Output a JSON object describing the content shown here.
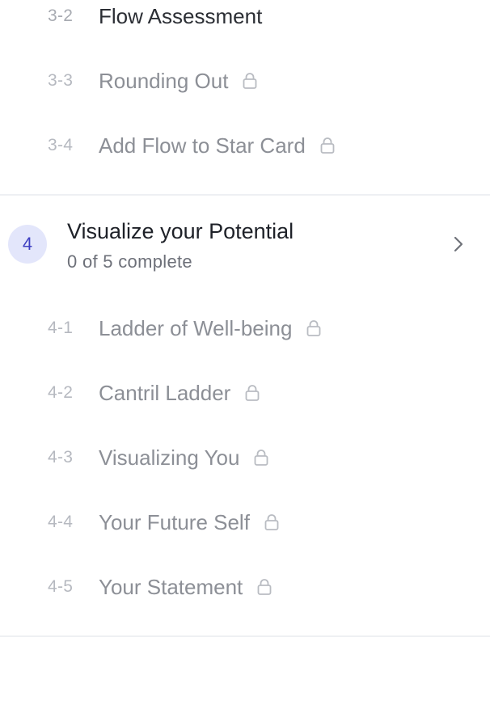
{
  "section3": {
    "lessons": [
      {
        "num": "3-2",
        "title": "Flow Assessment",
        "locked": false
      },
      {
        "num": "3-3",
        "title": "Rounding Out",
        "locked": true
      },
      {
        "num": "3-4",
        "title": "Add Flow to Star Card",
        "locked": true
      }
    ]
  },
  "section4": {
    "badge": "4",
    "title": "Visualize your Potential",
    "progress": "0 of 5 complete",
    "lessons": [
      {
        "num": "4-1",
        "title": "Ladder of Well-being",
        "locked": true
      },
      {
        "num": "4-2",
        "title": "Cantril Ladder",
        "locked": true
      },
      {
        "num": "4-3",
        "title": "Visualizing You",
        "locked": true
      },
      {
        "num": "4-4",
        "title": "Your Future Self",
        "locked": true
      },
      {
        "num": "4-5",
        "title": "Your Statement",
        "locked": true
      }
    ]
  },
  "icons": {
    "lock": "lock-icon",
    "chevron": "chevron-right-icon"
  },
  "colors": {
    "accent": "#3e3fc2",
    "badge_bg": "#e3e6fb",
    "active_text": "#2b2e34",
    "locked_text": "#8c8f96",
    "number_text": "#b6b9c0",
    "divider": "#eef0f3"
  }
}
